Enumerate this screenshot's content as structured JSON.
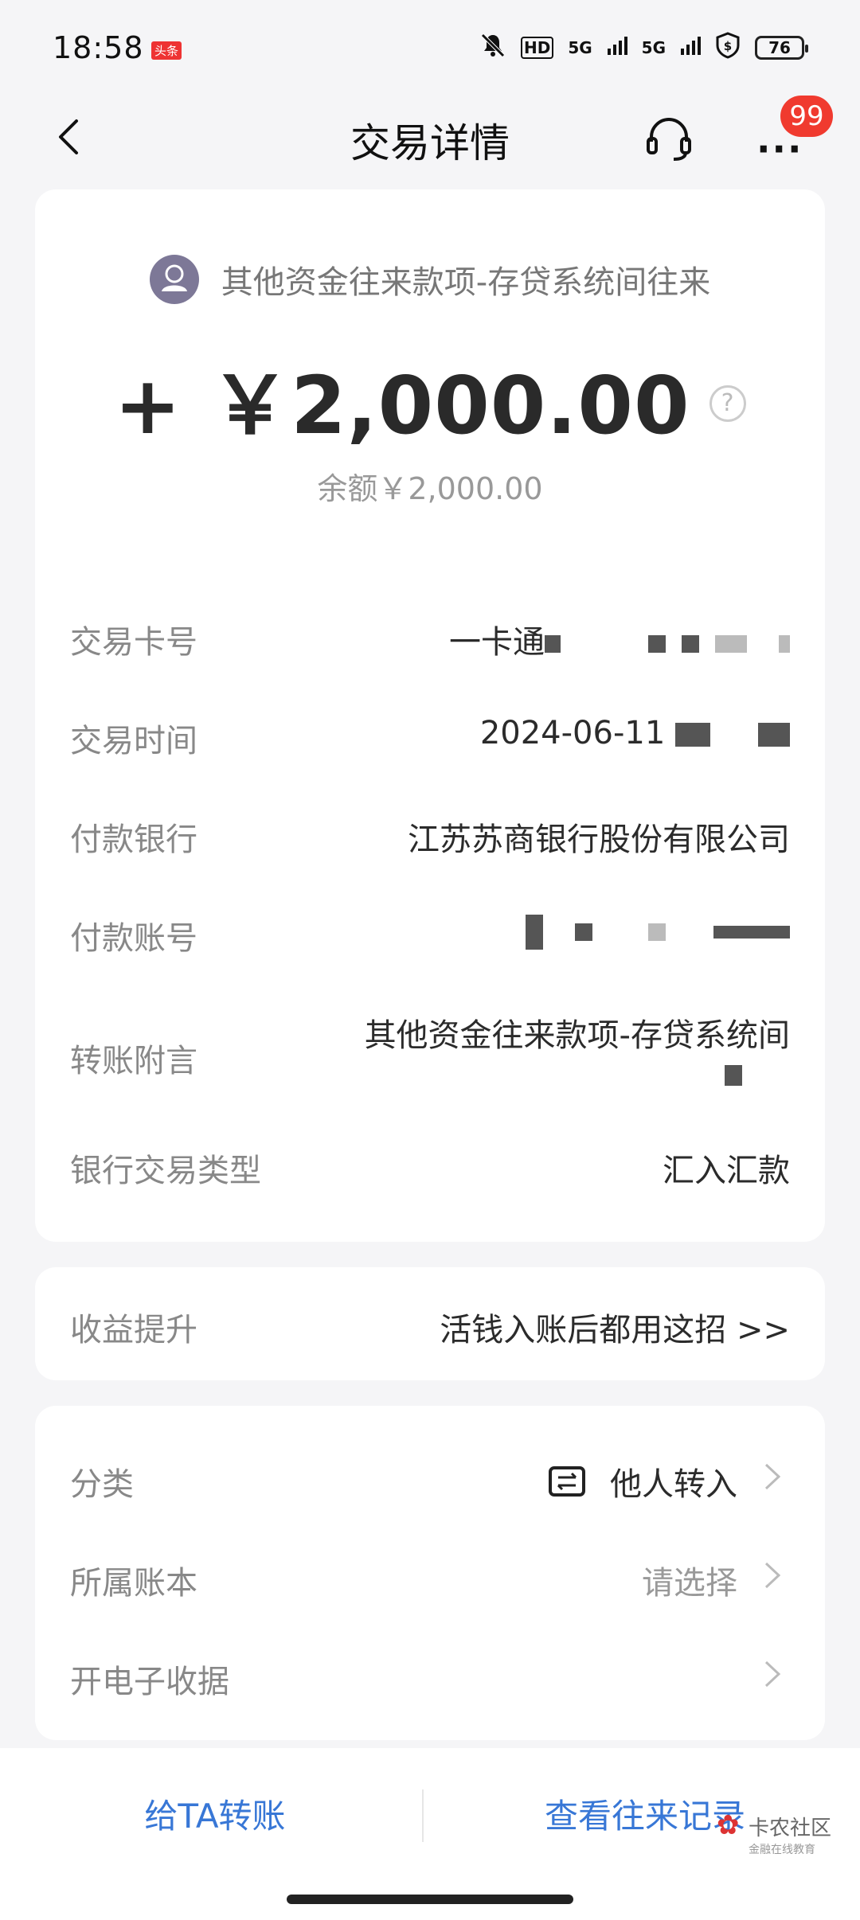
{
  "status_bar": {
    "time": "18:58",
    "app_badge": "头条",
    "hd": "HD",
    "signal1": "5G",
    "signal2": "5G",
    "battery": "76"
  },
  "nav": {
    "title": "交易详情",
    "badge_count": "99",
    "more": "···"
  },
  "transaction": {
    "payer": "其他资金往来款项-存贷系统间往来",
    "amount": "+ ￥2,000.00",
    "help": "?",
    "balance": "余额￥2,000.00"
  },
  "details": [
    {
      "label": "交易卡号",
      "value": "一卡通"
    },
    {
      "label": "交易时间",
      "value": "2024-06-11"
    },
    {
      "label": "付款银行",
      "value": "江苏苏商银行股份有限公司"
    },
    {
      "label": "付款账号",
      "value": ""
    },
    {
      "label": "转账附言",
      "value": "其他资金往来款项-存贷系统间"
    },
    {
      "label": "银行交易类型",
      "value": "汇入汇款"
    }
  ],
  "promo": {
    "label": "收益提升",
    "link": "活钱入账后都用这招 >>",
    "deco": "¥"
  },
  "settings": [
    {
      "label": "分类",
      "value": "他人转入"
    },
    {
      "label": "所属账本",
      "value": "请选择"
    },
    {
      "label": "开电子收据",
      "value": ""
    }
  ],
  "bottom": {
    "transfer": "给TA转账",
    "records": "查看往来记录"
  },
  "watermark": {
    "text": "卡农社区",
    "sub": "金融在线教育"
  },
  "colors": {
    "accent": "#3877d6",
    "badge": "#f03a2f",
    "avatar": "#7d7897"
  }
}
